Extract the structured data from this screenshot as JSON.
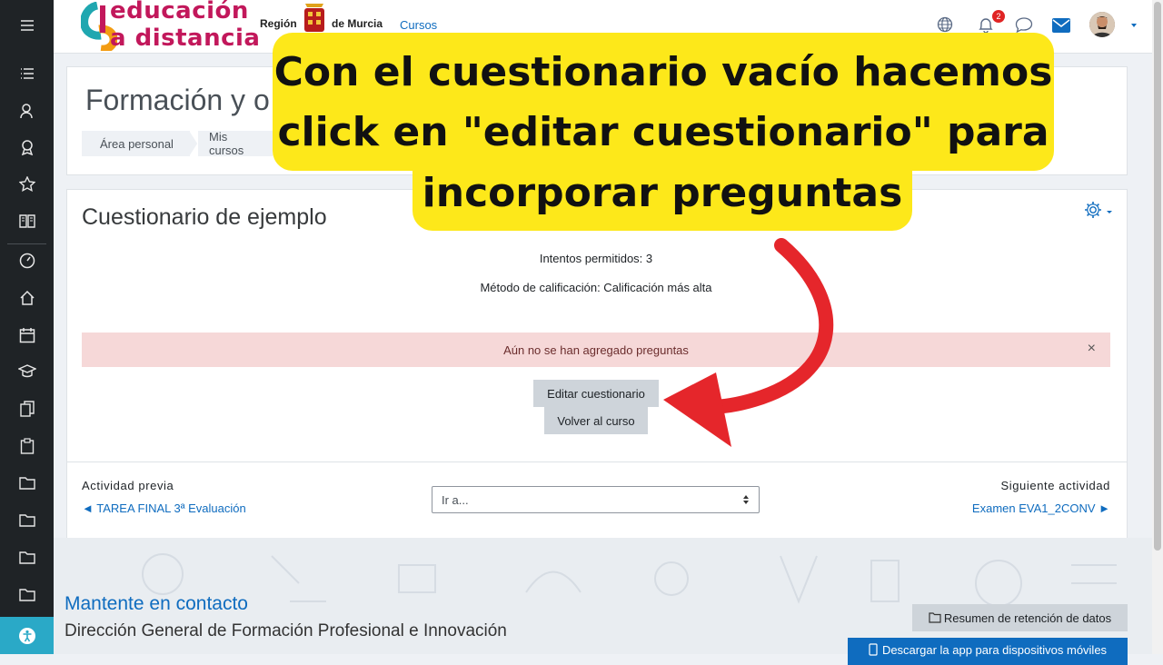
{
  "brand": {
    "logo_line1": "educación",
    "logo_line2": "a distancia",
    "region_left": "Región",
    "region_right": "de Murcia"
  },
  "nav": {
    "courses_link": "Cursos",
    "notification_count": "2"
  },
  "course": {
    "title": "Formación y o",
    "breadcrumbs": [
      "Área personal",
      "Mis cursos"
    ]
  },
  "quiz": {
    "title": "Cuestionario de ejemplo",
    "attempts": "Intentos permitidos: 3",
    "grading": "Método de calificación: Calificación más alta",
    "alert": "Aún no se han agregado preguntas",
    "alert_close": "×",
    "edit_button": "Editar cuestionario",
    "back_button": "Volver al curso"
  },
  "activity_nav": {
    "prev_label": "Actividad previa",
    "prev_link": "◄ TAREA FINAL 3ª Evaluación",
    "jump_placeholder": "Ir a...",
    "next_label": "Siguiente actividad",
    "next_link": "Examen EVA1_2CONV ►"
  },
  "footer": {
    "contact_title": "Mantente en contacto",
    "org_name": "Dirección General de Formación Profesional e Innovación",
    "data_retention_button": "Resumen de retención de datos",
    "mobile_app_button": "Descargar la app para dispositivos móviles"
  },
  "callout": {
    "line1": "Con el cuestionario vacío hacemos",
    "line2": "click en \"editar cuestionario\" para",
    "line3": "incorporar preguntas"
  },
  "colors": {
    "accent_link": "#0f6cbf",
    "callout_bg": "#fde81a",
    "arrow": "#e5262b",
    "sidebar": "#1f2326",
    "alert_bg": "#f6d8d8"
  }
}
